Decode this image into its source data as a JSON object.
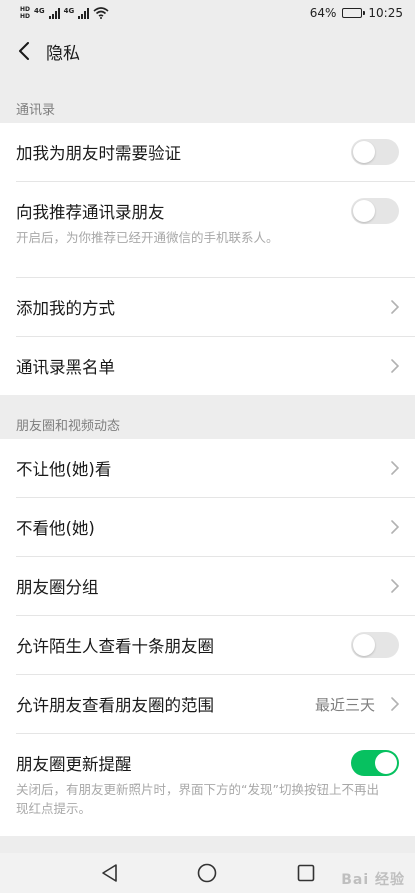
{
  "status_bar": {
    "sim1": "HD",
    "sim2": "HD",
    "net1": "4G",
    "net2": "4G",
    "battery_percent": "64%",
    "battery_level": 0.64,
    "time": "10:25"
  },
  "nav": {
    "title": "隐私"
  },
  "sections": [
    {
      "header": "通讯录",
      "rows": [
        {
          "label": "加我为朋友时需要验证",
          "control": "toggle",
          "on": false
        },
        {
          "label": "向我推荐通讯录朋友",
          "control": "toggle",
          "on": false,
          "desc": "开启后，为你推荐已经开通微信的手机联系人。"
        },
        {
          "label": "添加我的方式",
          "control": "chevron"
        },
        {
          "label": "通讯录黑名单",
          "control": "chevron"
        }
      ]
    },
    {
      "header": "朋友圈和视频动态",
      "rows": [
        {
          "label": "不让他(她)看",
          "control": "chevron"
        },
        {
          "label": "不看他(她)",
          "control": "chevron"
        },
        {
          "label": "朋友圈分组",
          "control": "chevron"
        },
        {
          "label": "允许陌生人查看十条朋友圈",
          "control": "toggle",
          "on": false
        },
        {
          "label": "允许朋友查看朋友圈的范围",
          "control": "chevron",
          "value": "最近三天"
        },
        {
          "label": "朋友圈更新提醒",
          "control": "toggle",
          "on": true,
          "desc": "关闭后，有朋友更新照片时，界面下方的“发现”切换按钮上不再出现红点提示。"
        }
      ]
    }
  ],
  "watermark": "Bai 经验",
  "colors": {
    "accent": "#07c160",
    "background": "#ededed",
    "toggle_off": "#e5e5e5"
  }
}
